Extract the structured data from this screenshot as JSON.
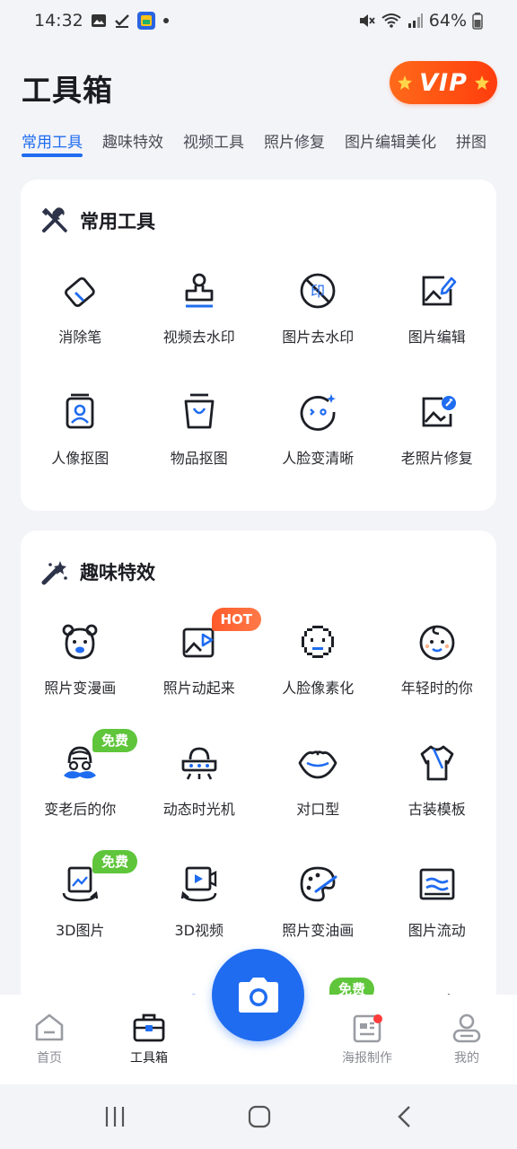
{
  "status_bar": {
    "time": "14:32",
    "battery": "64%",
    "icons": [
      "gallery-icon",
      "check-icon",
      "app-icon",
      "dot-icon",
      "mute-icon",
      "wifi-icon",
      "signal-icon",
      "battery-icon"
    ]
  },
  "header": {
    "title": "工具箱",
    "vip_label": "VIP"
  },
  "tabs": [
    {
      "label": "常用工具",
      "active": true
    },
    {
      "label": "趣味特效"
    },
    {
      "label": "视频工具"
    },
    {
      "label": "照片修复"
    },
    {
      "label": "图片编辑美化"
    },
    {
      "label": "拼图"
    }
  ],
  "sections": [
    {
      "title": "常用工具",
      "icon": "tools-icon",
      "items": [
        {
          "label": "消除笔",
          "icon": "eraser-icon"
        },
        {
          "label": "视频去水印",
          "icon": "stamp-icon"
        },
        {
          "label": "图片去水印",
          "icon": "no-print-icon"
        },
        {
          "label": "图片编辑",
          "icon": "image-edit-icon"
        },
        {
          "label": "人像抠图",
          "icon": "portrait-cutout-icon"
        },
        {
          "label": "物品抠图",
          "icon": "bag-cutout-icon"
        },
        {
          "label": "人脸变清晰",
          "icon": "face-sparkle-icon"
        },
        {
          "label": "老照片修复",
          "icon": "photo-repair-icon"
        }
      ]
    },
    {
      "title": "趣味特效",
      "icon": "magic-wand-icon",
      "items": [
        {
          "label": "照片变漫画",
          "icon": "bear-icon"
        },
        {
          "label": "照片动起来",
          "icon": "animated-photo-icon",
          "badge": "HOT"
        },
        {
          "label": "人脸像素化",
          "icon": "pixel-face-icon"
        },
        {
          "label": "年轻时的你",
          "icon": "baby-face-icon"
        },
        {
          "label": "变老后的你",
          "icon": "old-man-icon",
          "badge": "免费"
        },
        {
          "label": "动态时光机",
          "icon": "ufo-icon"
        },
        {
          "label": "对口型",
          "icon": "lips-icon"
        },
        {
          "label": "古装模板",
          "icon": "robe-icon"
        },
        {
          "label": "3D图片",
          "icon": "3d-image-icon",
          "badge": "免费"
        },
        {
          "label": "3D视频",
          "icon": "3d-video-icon"
        },
        {
          "label": "照片变油画",
          "icon": "palette-icon"
        },
        {
          "label": "图片流动",
          "icon": "flow-image-icon"
        }
      ],
      "partial_row_badge": "免费"
    }
  ],
  "bottom_nav": [
    {
      "label": "首页",
      "icon": "home-icon"
    },
    {
      "label": "工具箱",
      "icon": "toolbox-icon",
      "active": true
    },
    {
      "label": "海报制作",
      "icon": "poster-icon"
    },
    {
      "label": "我的",
      "icon": "profile-icon"
    }
  ],
  "camera_button": {
    "icon": "camera-icon"
  },
  "colors": {
    "accent": "#1f6cf0",
    "vip": "#ff4d14",
    "hot": "#ff5a2a",
    "free": "#5fc53a",
    "background": "#f3f4f8"
  }
}
